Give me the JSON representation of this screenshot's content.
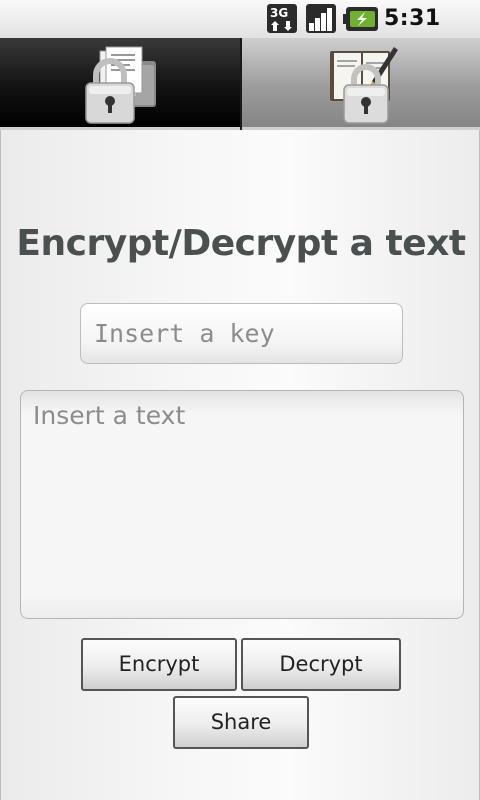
{
  "status_bar": {
    "network_type": "3G",
    "network_icon": "3g-data-icon",
    "signal_icon": "signal-strength-icon",
    "battery_icon": "battery-charging-icon",
    "time": "5:31 PM"
  },
  "tabs": [
    {
      "name": "encrypt-file",
      "icon": "file-lock-icon",
      "selected": true
    },
    {
      "name": "encrypt-text",
      "icon": "notebook-lock-icon",
      "selected": false
    }
  ],
  "main": {
    "title": "Encrypt/Decrypt a text",
    "key_input": {
      "placeholder": "Insert a key",
      "value": ""
    },
    "text_input": {
      "placeholder": "Insert a text",
      "value": ""
    },
    "buttons": {
      "encrypt": "Encrypt",
      "decrypt": "Decrypt",
      "share": "Share"
    }
  },
  "colors": {
    "title": "#4a4f50",
    "selected_tab": "#121212",
    "unselected_tab": "#9c9c9c",
    "background": "#f7f7f7"
  }
}
